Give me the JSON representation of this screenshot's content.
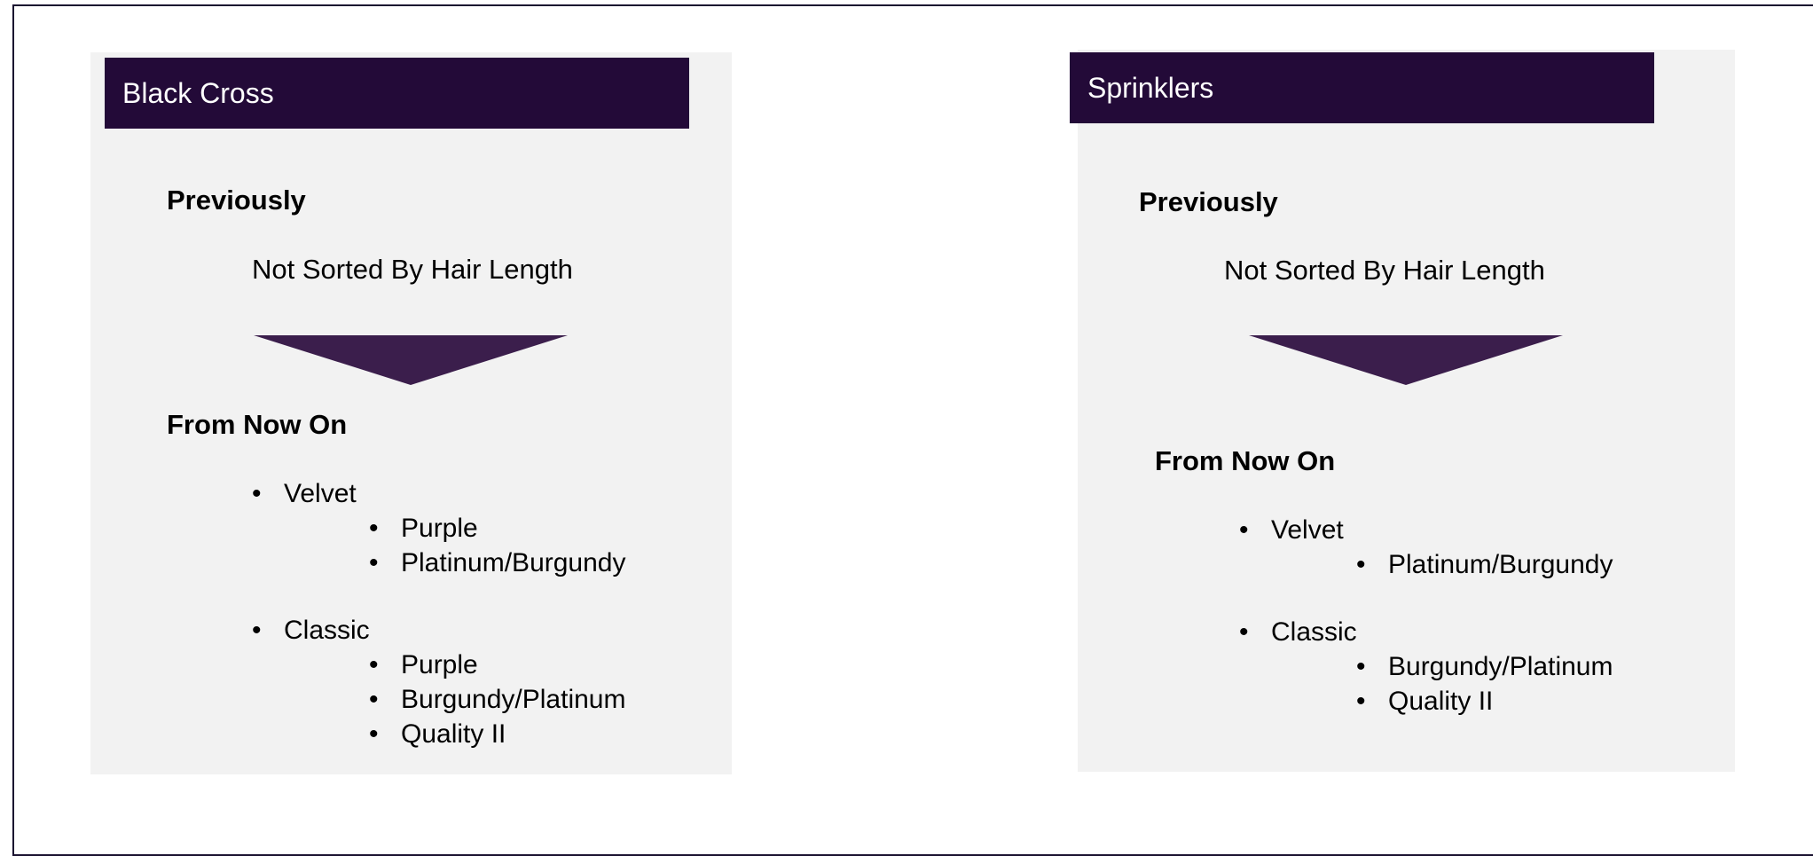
{
  "panels": [
    {
      "title": "Black Cross",
      "previously_heading": "Previously",
      "previously_text": "Not Sorted By Hair Length",
      "from_now_heading": "From Now On",
      "groups": [
        {
          "name": "Velvet",
          "items": [
            "Purple",
            "Platinum/Burgundy"
          ]
        },
        {
          "name": "Classic",
          "items": [
            "Purple",
            "Burgundy/Platinum",
            "Quality II"
          ]
        }
      ]
    },
    {
      "title": "Sprinklers",
      "previously_heading": "Previously",
      "previously_text": "Not Sorted By Hair Length",
      "from_now_heading": "From Now On",
      "groups": [
        {
          "name": "Velvet",
          "items": [
            "Platinum/Burgundy"
          ]
        },
        {
          "name": "Classic",
          "items": [
            "Burgundy/Platinum",
            "Quality II"
          ]
        }
      ]
    }
  ],
  "bullet_glyph": "•",
  "colors": {
    "header": "#230a38",
    "arrow": "#3b1e4c",
    "panel": "#f2f2f2"
  }
}
